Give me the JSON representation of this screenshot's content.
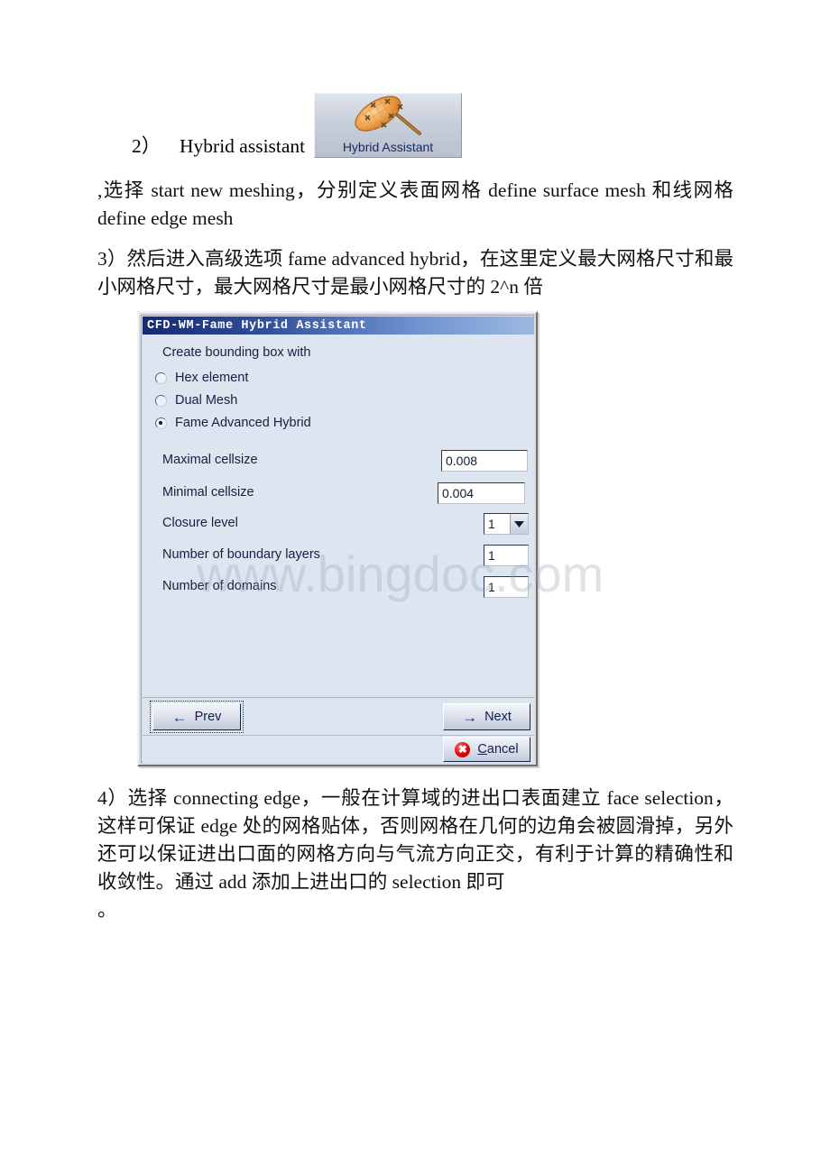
{
  "document": {
    "step2": {
      "number": "2）",
      "text": "Hybrid assistant",
      "toolbar_button_label": "Hybrid Assistant",
      "toolbar_button_icon": "mesh-paddle-icon"
    },
    "paragraph_select": ",选择 start new meshing，分别定义表面网格 define surface mesh 和线网格 define edge mesh",
    "paragraph_step3": "3）然后进入高级选项 fame advanced hybrid，在这里定义最大网格尺寸和最小网格尺寸，最大网格尺寸是最小网格尺寸的 2^n 倍",
    "paragraph_step4": "4）选择 connecting edge，一般在计算域的进出口表面建立 face selection，这样可保证 edge 处的网格贴体，否则网格在几何的边角会被圆滑掉，另外还可以保证进出口面的网格方向与气流方向正交，有利于计算的精确性和收敛性。通过 add 添加上进出口的 selection 即可",
    "paragraph_step4_tail": "。"
  },
  "watermark": {
    "text": "www.bingdoc.com"
  },
  "dialog": {
    "title": "CFD-WM-Fame Hybrid Assistant",
    "group_label": "Create bounding box with",
    "radios": [
      {
        "label": "Hex element",
        "selected": false
      },
      {
        "label": "Dual Mesh",
        "selected": false
      },
      {
        "label": "Fame Advanced Hybrid",
        "selected": true
      }
    ],
    "fields": [
      {
        "label": "Maximal cellsize",
        "value": "0.008",
        "type": "text"
      },
      {
        "label": "Minimal cellsize",
        "value": "0.004",
        "type": "text"
      },
      {
        "label": "Closure level",
        "value": "1",
        "type": "combo"
      },
      {
        "label": "Number of boundary layers",
        "value": "1",
        "type": "text"
      },
      {
        "label": "Number of domains",
        "value": "1",
        "type": "text"
      }
    ],
    "buttons": {
      "prev": {
        "label": "Prev",
        "icon": "arrow-left-icon"
      },
      "next": {
        "label": "Next",
        "icon": "arrow-right-icon"
      },
      "cancel": {
        "label_underlined": "C",
        "label_rest": "ancel",
        "icon": "error-x-icon"
      }
    },
    "colors": {
      "titlebar_start": "#172a6e",
      "titlebar_end": "#9bb8e0",
      "panel": "#dde5f1",
      "text": "#13213f",
      "cancel_icon": "#e00000"
    }
  }
}
